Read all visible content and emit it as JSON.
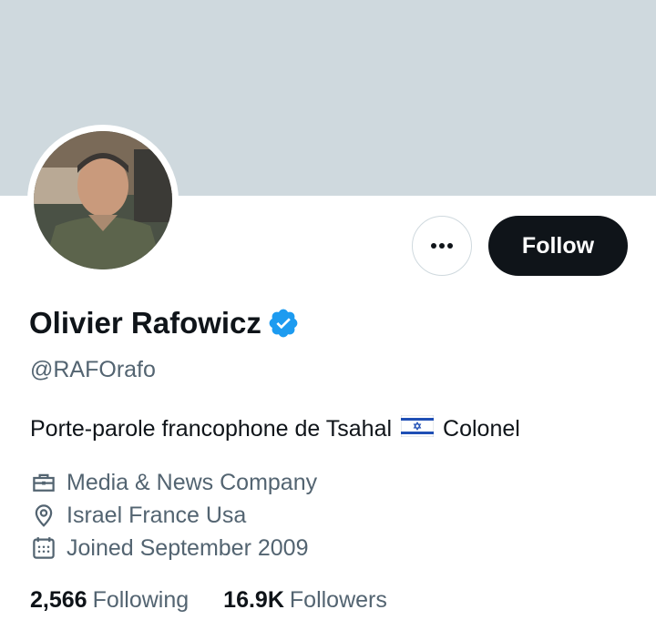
{
  "profile": {
    "name": "Olivier Rafowicz",
    "handle": "@RAFOrafo",
    "bio_text": "Porte-parole francophone de Tsahal",
    "bio_flag": "israel-flag-emoji",
    "bio_suffix": "Colonel",
    "verified": true
  },
  "actions": {
    "more_label": "more-options",
    "follow_label": "Follow"
  },
  "meta": {
    "category": "Media & News Company",
    "location": "Israel France Usa",
    "joined": "Joined September 2009"
  },
  "stats": {
    "following_count": "2,566",
    "following_label": "Following",
    "followers_count": "16.9K",
    "followers_label": "Followers"
  },
  "colors": {
    "banner": "#cfd9de",
    "verified_badge": "#1d9bf0",
    "primary_text": "#0f1419",
    "secondary_text": "#536471",
    "follow_button_bg": "#0f1419"
  }
}
